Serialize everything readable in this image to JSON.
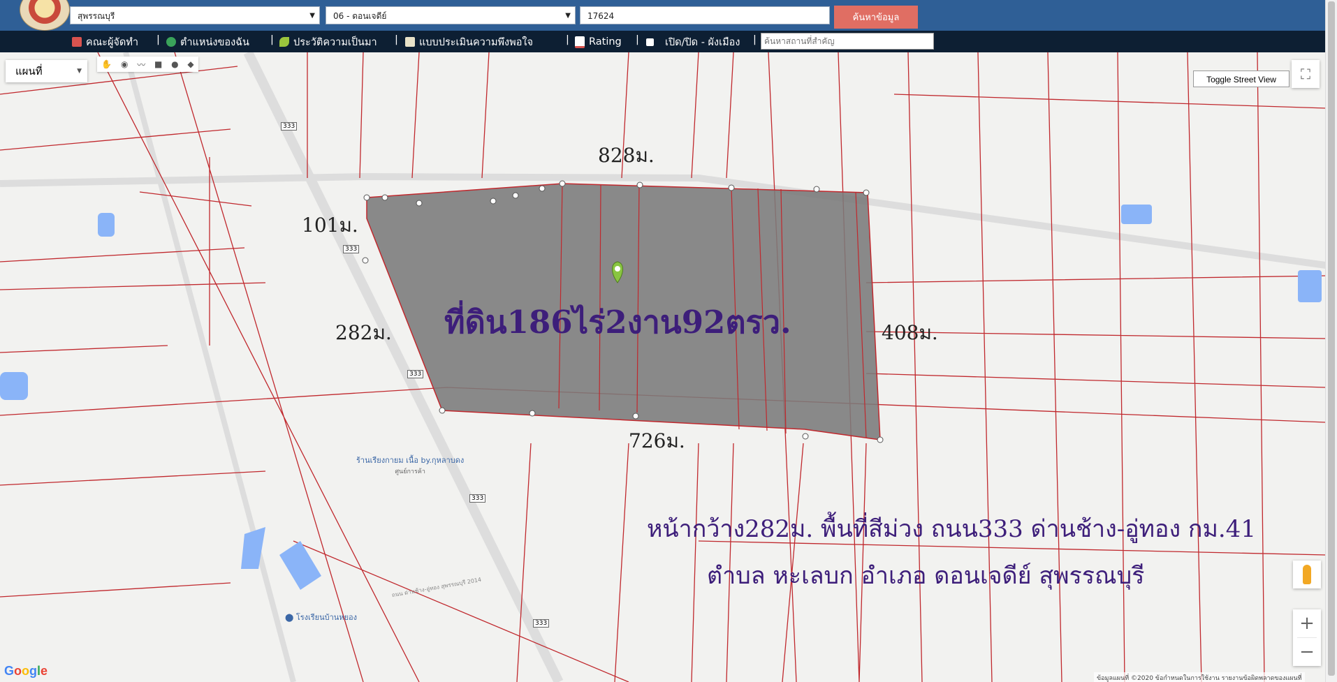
{
  "header": {
    "province_select": "สุพรรณบุรี",
    "district_select": "06 - ดอนเจดีย์",
    "deed_input": "17624",
    "search_button": "ค้นหาข้อมูล"
  },
  "nav": {
    "items": [
      {
        "label": "คณะผู้จัดทำ",
        "icon": "building-icon"
      },
      {
        "label": "ตำแหน่งของฉัน",
        "icon": "globe-icon"
      },
      {
        "label": "ประวัติความเป็นมา",
        "icon": "sprout-icon"
      },
      {
        "label": "แบบประเมินความพึงพอใจ",
        "icon": "document-icon"
      },
      {
        "label": "Rating",
        "icon": "chart-icon"
      },
      {
        "label": "เปิด/ปิด - ผังเมือง",
        "icon": "checkbox-icon"
      }
    ],
    "separator": "|",
    "place_search_placeholder": "ค้นหาสถานที่สำคัญ"
  },
  "map": {
    "map_type": "แผนที่",
    "toggle_street_view": "Toggle Street View",
    "parcel_label": "ที่ดิน186ไร่2งาน92ตรว.",
    "dimensions": {
      "top": "828ม.",
      "left_top": "101ม.",
      "left": "282ม.",
      "right": "408ม.",
      "bottom": "726ม."
    },
    "description_line1": "หน้ากว้าง282ม. พื้นที่สีม่วง ถนน333 ด่านช้าง-อู่ทอง กม.41",
    "description_line2": "ตำบล หะเลบก อำเภอ ดอนเจดีย์ สุพรรณบุรี",
    "road_shields": [
      "333",
      "333",
      "333",
      "333",
      "333"
    ],
    "pois": [
      {
        "name": "ร้านเรียงกายม เนื้อ by.กุหลาบดง",
        "sub": "ศูนย์การค้า"
      },
      {
        "name": "โรงเรียนบ้านหยอง"
      }
    ],
    "road_name": "ถนน ด่านช้าง-อู่ทอง สุพรรณบุรี 2014",
    "zoom_in": "+",
    "zoom_out": "−",
    "google": "Google",
    "attribution": "ข้อมูลแผนที่ ©2020   ข้อกำหนดในการใช้งาน   รายงานข้อผิดพลาดของแผนที่"
  },
  "colors": {
    "topbar": "#2f5f96",
    "navbar": "#0d1f33",
    "search_button": "#e06e63",
    "parcel_fill": "#7a7a7a",
    "parcel_lines": "#c0282d",
    "label_purple": "#3d1e7a"
  }
}
